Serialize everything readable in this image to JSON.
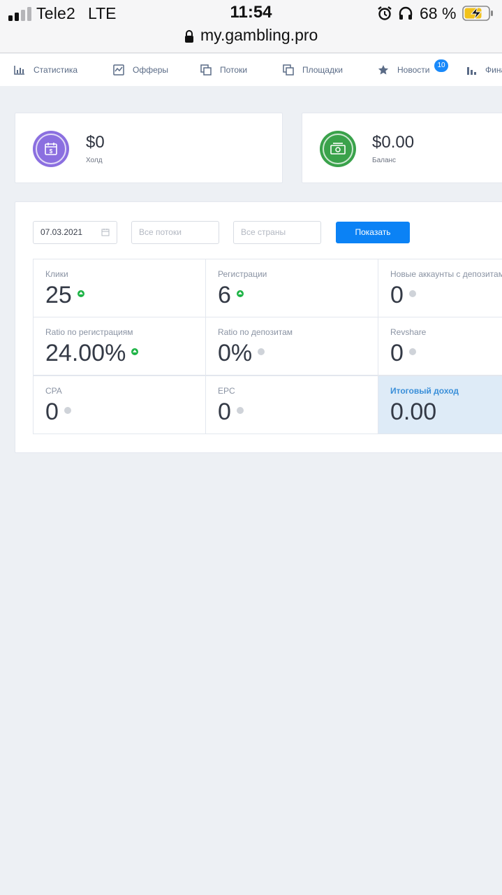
{
  "status_bar": {
    "carrier": "Tele2",
    "network": "LTE",
    "time": "11:54",
    "battery_percent": "68 %",
    "signal_bars_active": 2,
    "signal_bars_total": 4,
    "icons": [
      "signal-icon",
      "alarm-icon",
      "headphones-icon",
      "battery-charging-icon"
    ]
  },
  "browser": {
    "url": "my.gambling.pro",
    "icon": "lock-icon"
  },
  "nav": {
    "items": [
      {
        "label": "Статистика",
        "icon": "bar-chart-icon"
      },
      {
        "label": "Офферы",
        "icon": "trend-box-icon"
      },
      {
        "label": "Потоки",
        "icon": "copy-icon"
      },
      {
        "label": "Площадки",
        "icon": "copy-icon"
      },
      {
        "label": "Новости",
        "icon": "star-icon",
        "badge": "10"
      },
      {
        "label": "Фина",
        "icon": "bar-chart-icon"
      }
    ]
  },
  "summary": {
    "hold": {
      "value": "$0",
      "label": "Холд",
      "icon": "calendar-dollar-icon",
      "color": "#8b6fe0"
    },
    "balance": {
      "value": "$0.00",
      "label": "Баланс",
      "icon": "banknote-icon",
      "color": "#3aa24b"
    }
  },
  "filters": {
    "date": "07.03.2021",
    "streams_placeholder": "Все потоки",
    "countries_placeholder": "Все страны",
    "show_label": "Показать"
  },
  "metrics": [
    {
      "label": "Клики",
      "value": "25",
      "trend": "up"
    },
    {
      "label": "Регистрации",
      "value": "6",
      "trend": "up"
    },
    {
      "label": "Новые аккаунты с депозитам",
      "value": "0",
      "trend": "neutral"
    },
    {
      "label": "Ratio по регистрациям",
      "value": "24.00%",
      "trend": "up"
    },
    {
      "label": "Ratio по депозитам",
      "value": "0%",
      "trend": "neutral"
    },
    {
      "label": "Revshare",
      "value": "0",
      "trend": "neutral"
    },
    {
      "label": "CPA",
      "value": "0",
      "trend": "neutral"
    },
    {
      "label": "EPC",
      "value": "0",
      "trend": "neutral"
    },
    {
      "label": "Итоговый доход",
      "value": "0.00",
      "trend": "none"
    }
  ],
  "colors": {
    "accent": "#0b82f5",
    "badge": "#1989fa",
    "up": "#1fb447",
    "neutral": "#cfd3d9",
    "highlight_bg": "#deebf7",
    "highlight_text": "#3a8fd9"
  }
}
